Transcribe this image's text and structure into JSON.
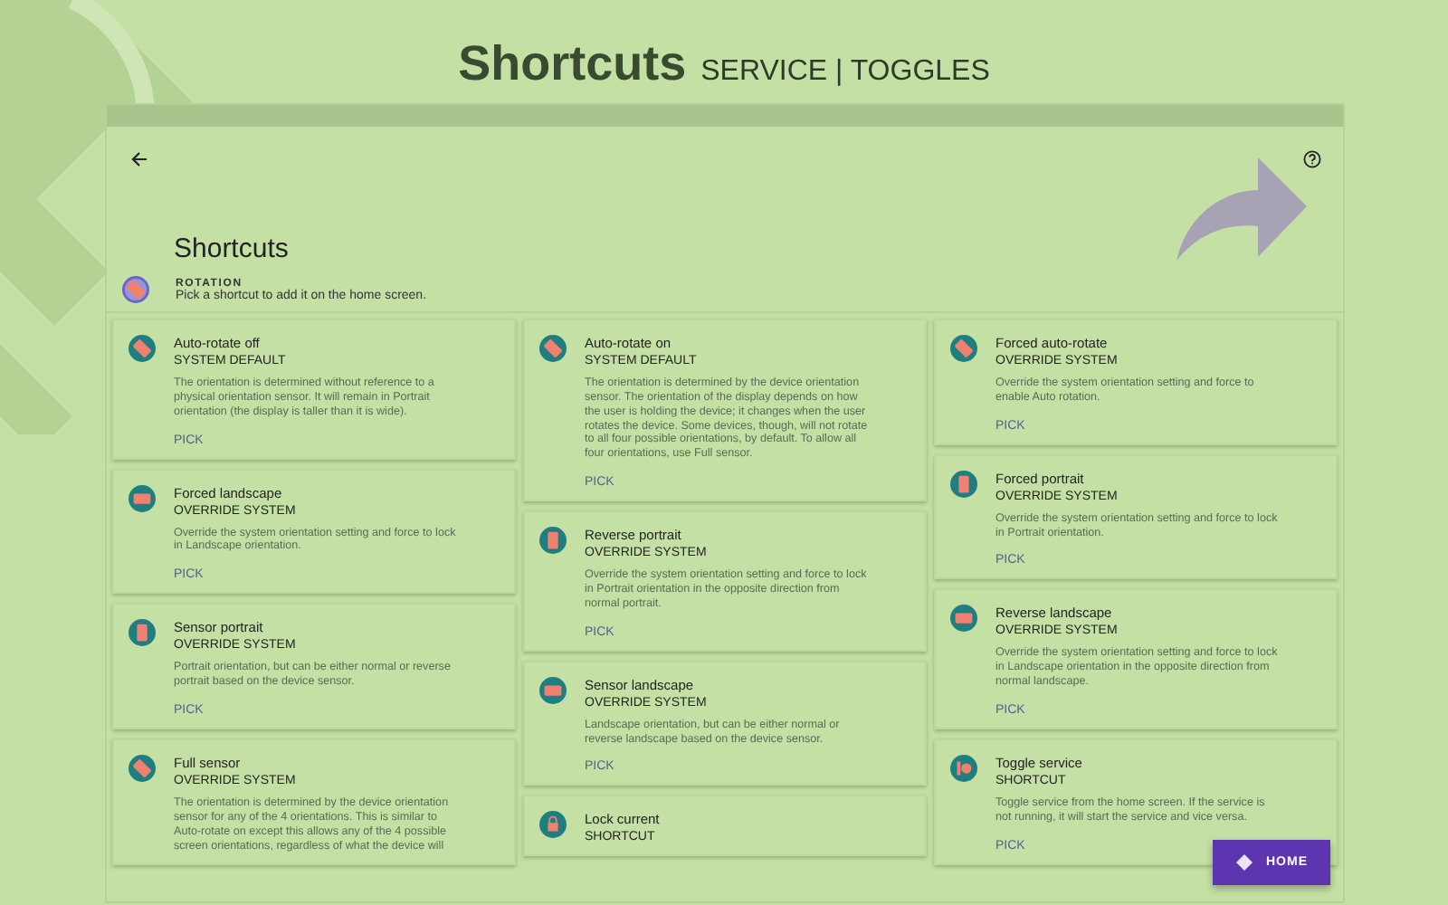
{
  "header": {
    "title": "Shortcuts",
    "subtitle": "SERVICE | TOGGLES"
  },
  "panel": {
    "title": "Shortcuts",
    "category": {
      "label": "ROTATION",
      "description": "Pick a shortcut to add it on the home screen."
    }
  },
  "columns": [
    [
      {
        "title": "Auto-rotate off",
        "type": "SYSTEM DEFAULT",
        "kind": "tilted",
        "description": "The orientation is determined without reference to a physical orientation sensor. It will remain in Portrait orientation (the display is taller than it is wide).",
        "action": "PICK"
      },
      {
        "title": "Forced landscape",
        "type": "OVERRIDE SYSTEM",
        "kind": "landscape",
        "description": "Override the system orientation setting and force to lock in Landscape orientation.",
        "action": "PICK"
      },
      {
        "title": "Sensor portrait",
        "type": "OVERRIDE SYSTEM",
        "kind": "portrait",
        "description": "Portrait orientation, but can be either normal or reverse portrait based on the device sensor.",
        "action": "PICK"
      },
      {
        "title": "Full sensor",
        "type": "OVERRIDE SYSTEM",
        "kind": "tilted",
        "description": "The orientation is determined by the device orientation sensor for any of the 4 orientations. This is similar to Auto-rotate on except this allows any of the 4 possible screen orientations, regardless of what the device will"
      }
    ],
    [
      {
        "title": "Auto-rotate on",
        "type": "SYSTEM DEFAULT",
        "kind": "tilted",
        "description": "The orientation is determined by the device orientation sensor. The orientation of the display depends on how the user is holding the device; it changes when the user rotates the device. Some devices, though, will not rotate to all four possible orientations, by default. To allow all four orientations, use Full sensor.",
        "action": "PICK"
      },
      {
        "title": "Reverse portrait",
        "type": "OVERRIDE SYSTEM",
        "kind": "portrait",
        "description": "Override the system orientation setting and force to lock in Portrait orientation in the opposite direction from normal portrait.",
        "action": "PICK"
      },
      {
        "title": "Sensor landscape",
        "type": "OVERRIDE SYSTEM",
        "kind": "landscape",
        "description": "Landscape orientation, but can be either normal or reverse landscape based on the device sensor.",
        "action": "PICK"
      },
      {
        "title": "Lock current",
        "type": "SHORTCUT",
        "kind": "lock"
      }
    ],
    [
      {
        "title": "Forced auto-rotate",
        "type": "OVERRIDE SYSTEM",
        "kind": "tilted",
        "description": "Override the system orientation setting and force to enable Auto rotation.",
        "action": "PICK"
      },
      {
        "title": "Forced portrait",
        "type": "OVERRIDE SYSTEM",
        "kind": "portrait",
        "description": "Override the system orientation setting and force to lock in Portrait orientation.",
        "action": "PICK"
      },
      {
        "title": "Reverse landscape",
        "type": "OVERRIDE SYSTEM",
        "kind": "landscape",
        "description": "Override the system orientation setting and force to lock in Landscape orientation in the opposite direction from normal landscape.",
        "action": "PICK"
      },
      {
        "title": "Toggle service",
        "type": "SHORTCUT",
        "kind": "toggle",
        "description": "Toggle service from the home screen. If the service is not running, it will start the service and vice versa.",
        "action": "PICK"
      }
    ]
  ],
  "fab": {
    "label": "HOME"
  }
}
